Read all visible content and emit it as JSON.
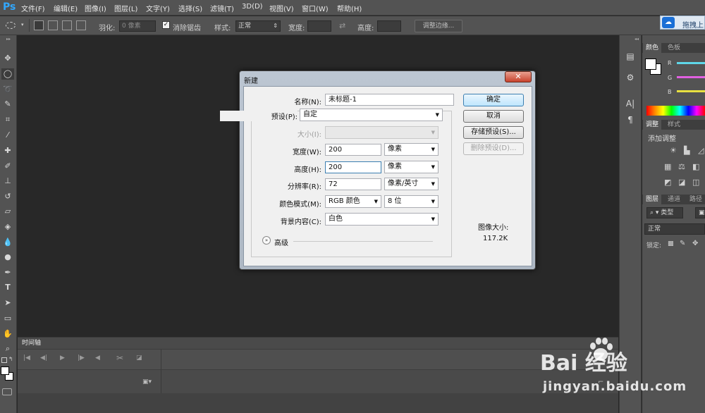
{
  "app": {
    "logo": "Ps"
  },
  "menu": [
    "文件(F)",
    "编辑(E)",
    "图像(I)",
    "图层(L)",
    "文字(Y)",
    "选择(S)",
    "滤镜(T)",
    "3D(D)",
    "视图(V)",
    "窗口(W)",
    "帮助(H)"
  ],
  "options": {
    "feather_label": "羽化:",
    "feather_value": "0 像素",
    "antialias_label": "消除锯齿",
    "style_label": "样式:",
    "style_value": "正常",
    "width_label": "宽度:",
    "height_label": "高度:",
    "refine_edge": "调整边缘...",
    "cloud_button": "拖拽上"
  },
  "timeline": {
    "tab": "时间轴"
  },
  "right_panels": {
    "color_tabs": [
      "颜色",
      "色板"
    ],
    "color_channels": [
      "R",
      "G",
      "B"
    ],
    "channel_colors": [
      "#5fd6e8",
      "#e060e0",
      "#e8e040"
    ],
    "adjust_tabs": [
      "调整",
      "样式"
    ],
    "adjust_title": "添加调整",
    "layers_tabs": [
      "图层",
      "通道",
      "路径"
    ],
    "layers_filter": "类型",
    "layers_blend": "正常",
    "layers_lock": "锁定:"
  },
  "dialog": {
    "title": "新建",
    "close": "✕",
    "name_label": "名称(N):",
    "name_value": "未标题-1",
    "preset_label": "预设(P):",
    "preset_value": "自定",
    "size_label": "大小(I):",
    "width_label": "宽度(W):",
    "width_value": "200",
    "width_unit": "像素",
    "height_label": "高度(H):",
    "height_value": "200",
    "height_unit": "像素",
    "resolution_label": "分辨率(R):",
    "resolution_value": "72",
    "resolution_unit": "像素/英寸",
    "color_mode_label": "颜色模式(M):",
    "color_mode_value": "RGB 颜色",
    "bit_depth": "8 位",
    "background_label": "背景内容(C):",
    "background_value": "白色",
    "advanced_label": "高级",
    "ok": "确定",
    "cancel": "取消",
    "save_preset": "存储预设(S)...",
    "delete_preset": "删除预设(D)...",
    "image_size_label": "图像大小:",
    "image_size_value": "117.2K"
  },
  "watermark": {
    "brand": "Bai  经验",
    "url": "jingyan.baidu.com"
  }
}
